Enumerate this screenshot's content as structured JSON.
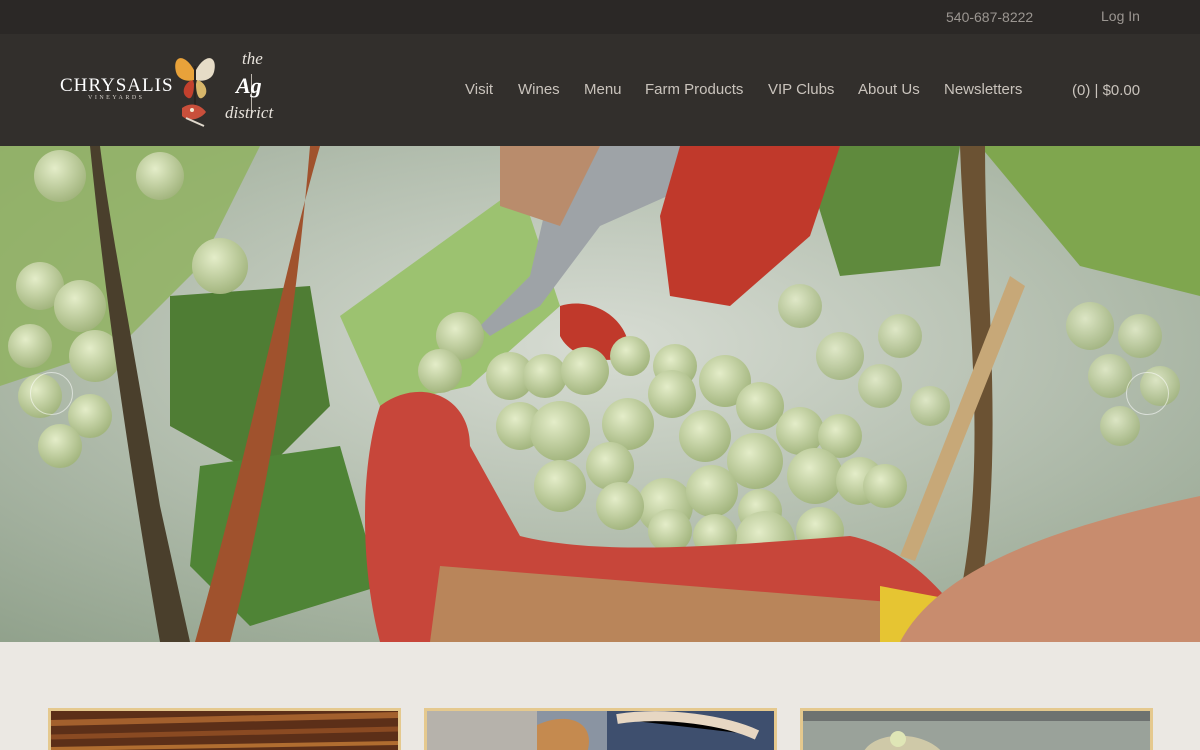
{
  "topbar": {
    "phone": "540-687-8222",
    "login_label": "Log In"
  },
  "logo": {
    "brand": "CHRYSALIS",
    "brand_sub": "VINEYARDS",
    "the": "the",
    "ag": "Ag",
    "district": "district"
  },
  "nav": {
    "items": [
      {
        "label": "Visit"
      },
      {
        "label": "Wines"
      },
      {
        "label": "Menu"
      },
      {
        "label": "Farm Products"
      },
      {
        "label": "VIP Clubs"
      },
      {
        "label": "About Us"
      },
      {
        "label": "Newsletters"
      }
    ],
    "cart_label": "(0) | $0.00"
  },
  "hero": {
    "description_icon": "grape-harvest-photo",
    "prev_icon": "chevron-left-icon",
    "next_icon": "chevron-right-icon"
  },
  "cards": [
    {
      "image": "barrel-room-photo"
    },
    {
      "image": "food-plate-photo"
    },
    {
      "image": "vineyard-photo"
    }
  ],
  "colors": {
    "topbar_bg": "#2b2826",
    "header_bg": "#322f2c",
    "nav_text": "#c9c3bc",
    "page_bg": "#ebe8e3",
    "card_border": "#e5c98e"
  }
}
